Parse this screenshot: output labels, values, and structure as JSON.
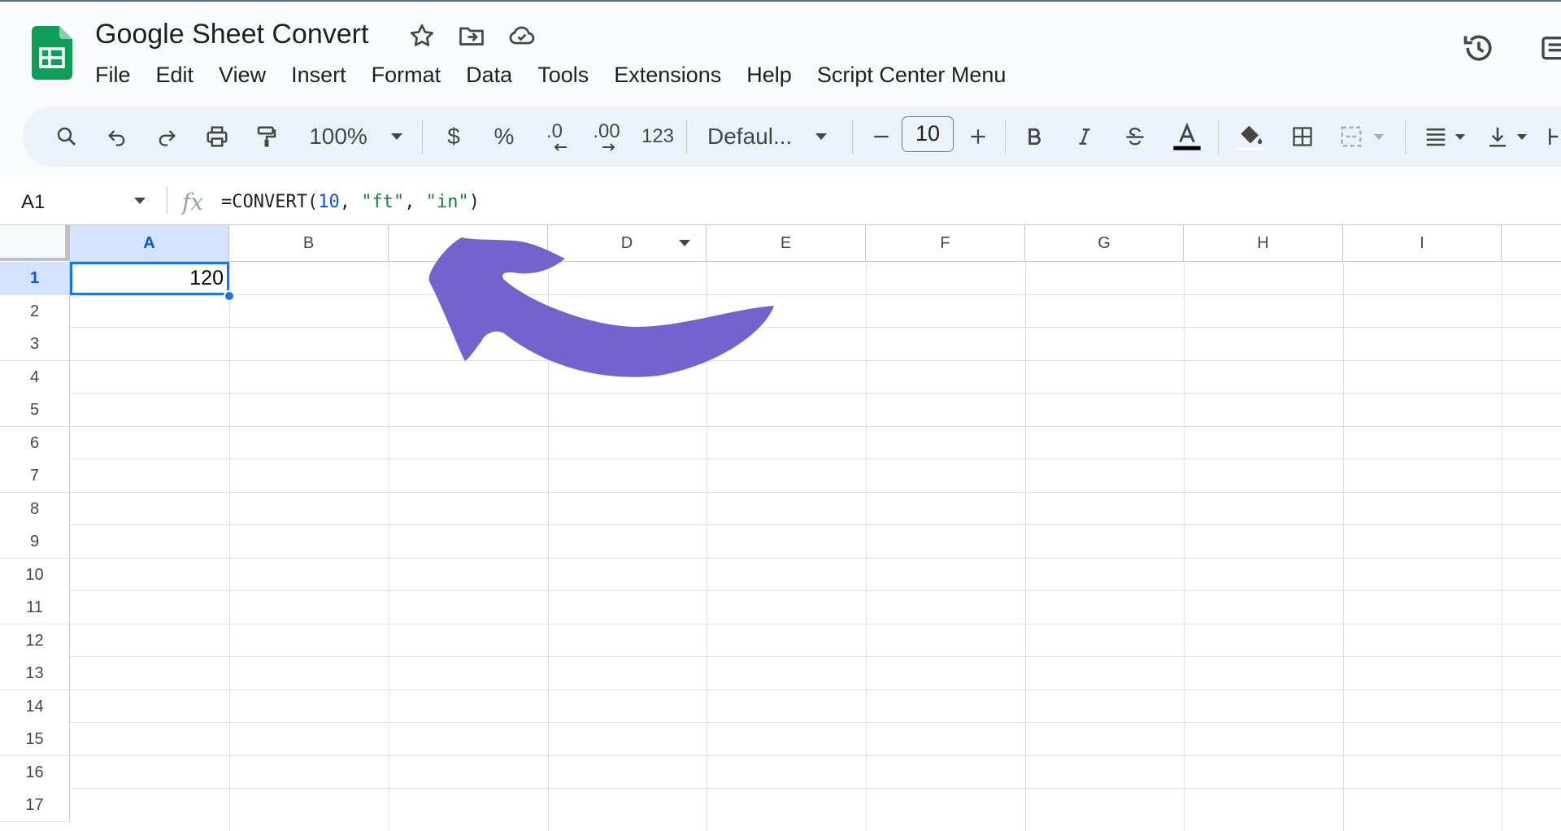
{
  "app": {
    "doc_title": "Google Sheet Convert",
    "menus": [
      "File",
      "Edit",
      "View",
      "Insert",
      "Format",
      "Data",
      "Tools",
      "Extensions",
      "Help",
      "Script Center Menu"
    ]
  },
  "toolbar": {
    "zoom": "100%",
    "currency": "$",
    "percent": "%",
    "decrease_decimal": ".0",
    "increase_decimal": ".00",
    "more_formats": "123",
    "font": "Defaul...",
    "font_size": "10",
    "text_color": "#000000",
    "icons": [
      "search-icon",
      "undo-icon",
      "redo-icon",
      "print-icon",
      "paint-format-icon",
      "bold-icon",
      "italic-icon",
      "strikethrough-icon",
      "text-color-icon",
      "fill-color-icon",
      "borders-icon",
      "merge-cells-icon",
      "align-icon",
      "vertical-align-icon"
    ]
  },
  "formula_bar": {
    "cell_ref": "A1",
    "fx": "fx",
    "formula_prefix": "=CONVERT(",
    "arg_number": "10",
    "sep1": ", ",
    "arg_from": "\"ft\"",
    "sep2": ", ",
    "arg_to": "\"in\"",
    "formula_suffix": ")"
  },
  "sheet": {
    "columns": [
      "A",
      "B",
      "",
      "D",
      "E",
      "F",
      "G",
      "H",
      "I"
    ],
    "rows": [
      "1",
      "2",
      "3",
      "4",
      "5",
      "6",
      "7",
      "8",
      "9",
      "10",
      "11",
      "12",
      "13",
      "14",
      "15",
      "16",
      "17"
    ],
    "selected_cell": "A1",
    "cells": {
      "A1": "120"
    }
  },
  "colors": {
    "accent": "#1a73e8",
    "selection_header": "#d3e3fd",
    "annotation_arrow": "#7463cc",
    "logo_green": "#0f9d58"
  }
}
